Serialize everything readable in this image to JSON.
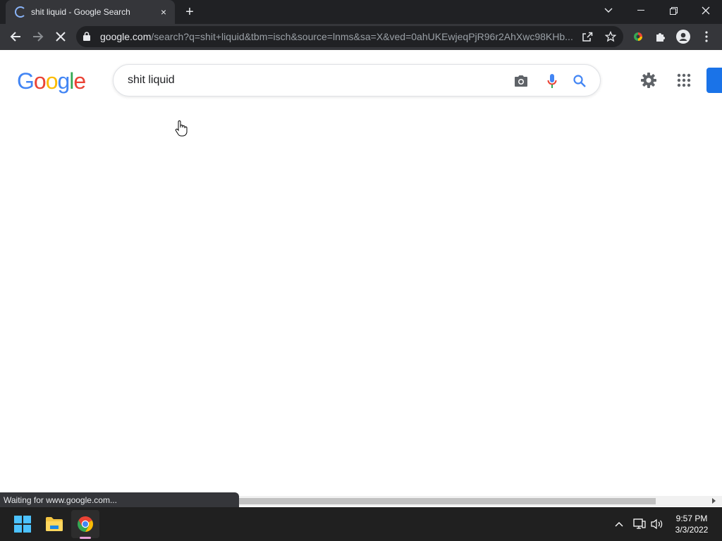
{
  "browser": {
    "tab": {
      "title": "shit liquid - Google Search",
      "close": "×"
    },
    "new_tab": "+",
    "url_host": "google.com",
    "url_rest": "/search?q=shit+liquid&tbm=isch&source=lnms&sa=X&ved=0ahUKEwjeqPjR96r2AhXwc98KHb..."
  },
  "page": {
    "logo": [
      "G",
      "o",
      "o",
      "g",
      "l",
      "e"
    ],
    "search_query": "shit liquid"
  },
  "status": {
    "text": "Waiting for www.google.com..."
  },
  "taskbar": {
    "time": "9:57 PM",
    "date": "3/3/2022"
  },
  "colors": {
    "google_blue": "#4285f4",
    "google_red": "#ea4335",
    "google_yellow": "#fbbc05",
    "google_green": "#34a853",
    "accent_blue": "#1a73e8"
  }
}
